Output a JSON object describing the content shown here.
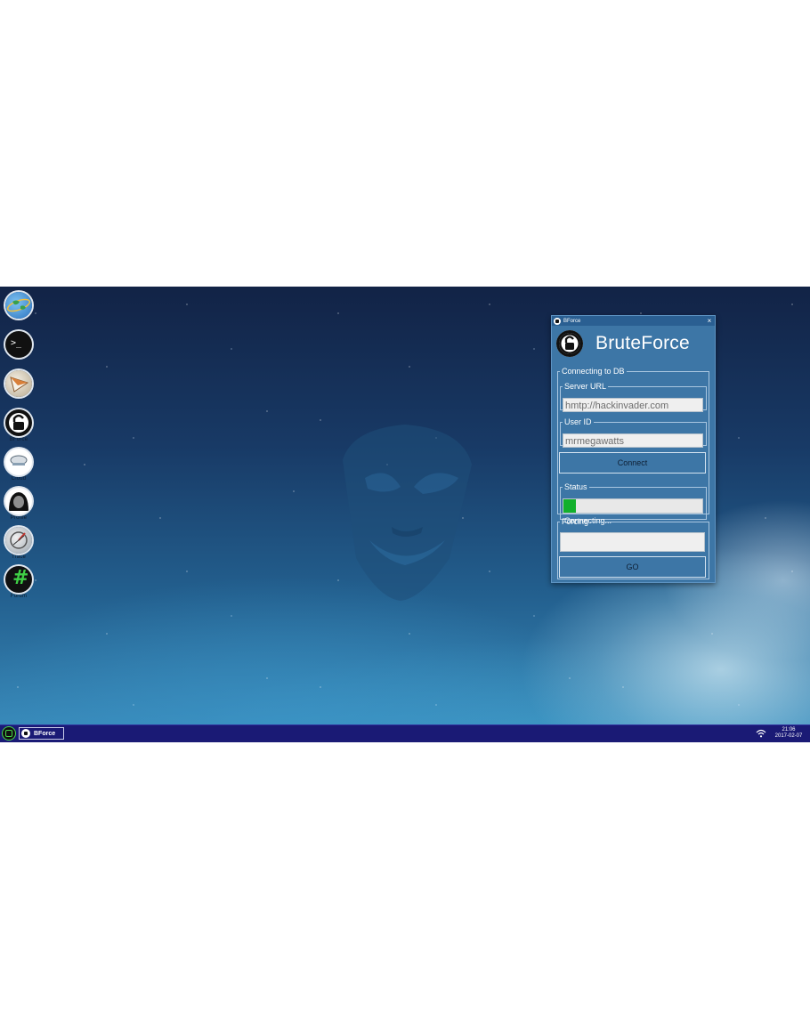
{
  "desktop": {
    "icons": [
      {
        "name": "browser-icon",
        "label": ""
      },
      {
        "name": "terminal-icon",
        "label": ""
      },
      {
        "name": "mail-icon",
        "label": ""
      },
      {
        "name": "bforce-icon",
        "label": "BForce"
      },
      {
        "name": "cloud-icon",
        "label": "Cloud"
      },
      {
        "name": "profile-icon",
        "label": "Profile"
      },
      {
        "name": "trace-icon",
        "label": "Trace"
      },
      {
        "name": "hashtag-icon",
        "label": "Forum"
      }
    ],
    "terminal_glyph": ">_",
    "hashtag_glyph": "#"
  },
  "window": {
    "title": "BForce",
    "close_glyph": "×",
    "app_title": "BruteForce",
    "connecting_group": "Connecting to DB",
    "server_url_label": "Server URL",
    "server_url_value": "hmtp://hackinvader.com",
    "user_id_label": "User ID",
    "user_id_value": "mrmegawatts",
    "connect_button": "Connect",
    "status_label": "Status",
    "status_text": "Connecting...",
    "progress_percent": 9,
    "forcing_label": "Forcing",
    "forcing_value": "",
    "go_button": "GO"
  },
  "taskbar": {
    "task_label": "BForce",
    "time": "21:06",
    "date": "2017-02-07"
  },
  "colors": {
    "window_bg": "#3d76a6",
    "title_bar": "#2a5f92",
    "taskbar": "#1a1a75",
    "progress_fill": "#12b02c",
    "accent_green": "#47d64a"
  }
}
